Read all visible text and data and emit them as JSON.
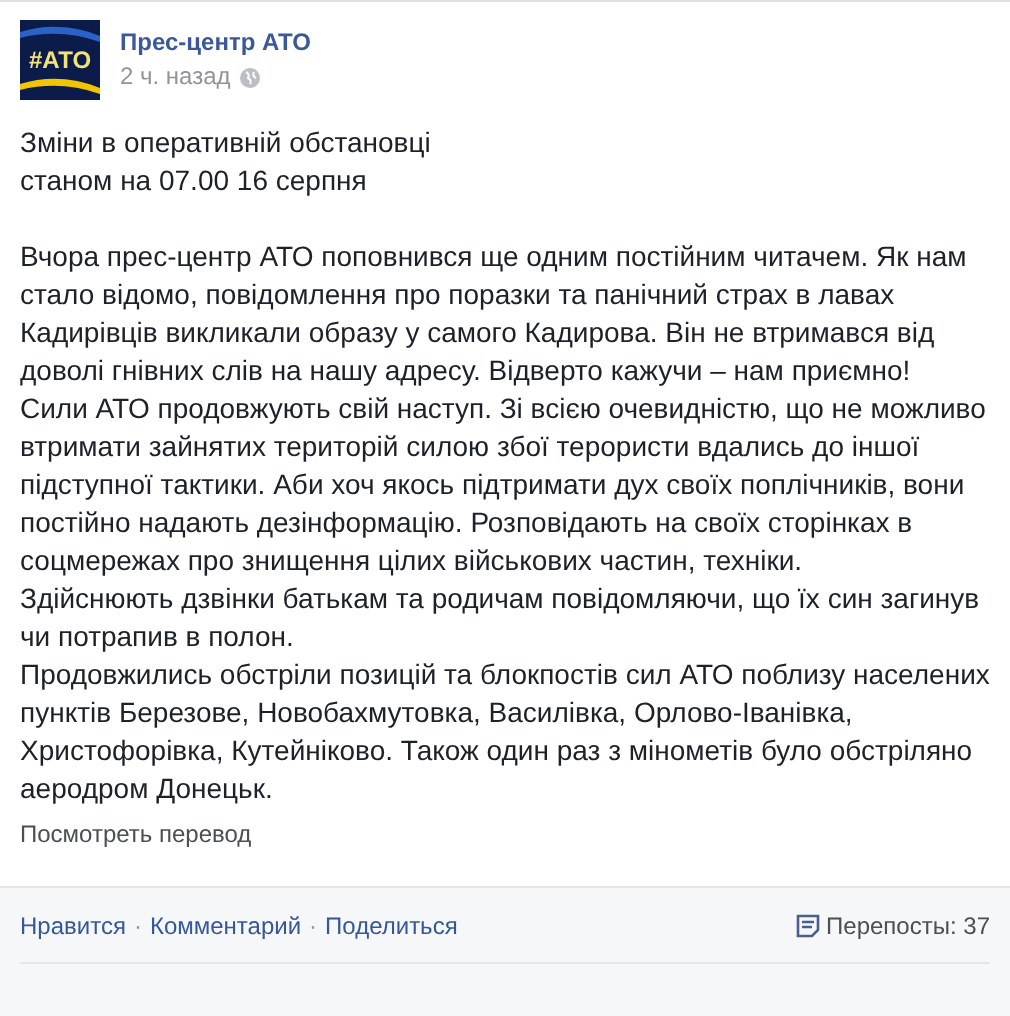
{
  "post": {
    "author": "Прес-центр АТО",
    "avatar_text": "#АТО",
    "time": "2 ч. назад",
    "title_lines": [
      "Зміни в оперативній обстановці",
      "станом на 07.00 16 серпня"
    ],
    "paragraphs": [
      "Вчора прес-центр АТО поповнився ще одним постійним читачем. Як нам стало відомо, повідомлення про поразки та панічний страх в лавах Кадирівців викликали образу у самого Кадирова. Він не втримався від доволі гнівних слів на нашу адресу. Відверто кажучи – нам приємно!",
      "Сили АТО продовжують свій наступ. Зі всією очевидністю, що не можливо втримати зайнятих територій силою збої терористи вдались до іншої підступної тактики. Аби хоч якось підтримати дух своїх поплічників, вони постійно надають дезінформацію. Розповідають на своїх сторінках в соцмережах про знищення цілих військових частин, техніки.",
      "Здійснюють дзвінки батькам та родичам повідомляючи, що їх син загинув чи потрапив в полон.",
      "Продовжились обстріли позицій та блокпостів сил АТО поблизу населених пунктів Березове, Новобахмутовка, Василівка, Орлово-Іванівка, Христофорівка, Кутейніково. Також один раз з мінометів було обстріляно аеродром Донецьк."
    ],
    "translate_link": "Посмотреть перевод"
  },
  "footer": {
    "actions": [
      "Нравится",
      "Комментарий",
      "Поделиться"
    ],
    "separator": "·",
    "shares": "Перепосты: 37"
  }
}
